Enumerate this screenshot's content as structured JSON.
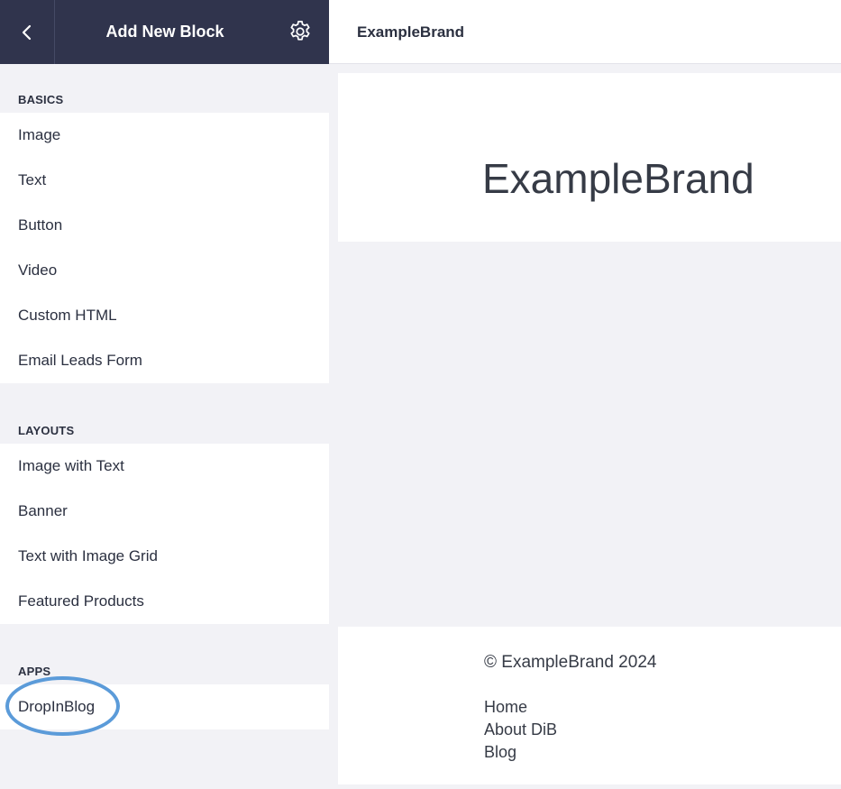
{
  "sidebar": {
    "title": "Add New Block",
    "back_icon": "chevron-left-icon",
    "settings_icon": "gear-icon",
    "sections": {
      "basics": {
        "label": "BASICS",
        "items": [
          "Image",
          "Text",
          "Button",
          "Video",
          "Custom HTML",
          "Email Leads Form"
        ]
      },
      "layouts": {
        "label": "LAYOUTS",
        "items": [
          "Image with Text",
          "Banner",
          "Text with Image Grid",
          "Featured Products"
        ]
      },
      "apps": {
        "label": "APPS",
        "items": [
          "DropInBlog"
        ]
      }
    }
  },
  "topbar": {
    "brand": "ExampleBrand"
  },
  "preview": {
    "logo_text": "ExampleBrand",
    "footer": {
      "copyright": "© ExampleBrand 2024",
      "links": [
        "Home",
        "About DiB",
        "Blog"
      ]
    }
  },
  "colors": {
    "sidebar_header": "#30344d",
    "highlight": "#5b9bd9",
    "canvas_bg": "#f2f2f6"
  }
}
